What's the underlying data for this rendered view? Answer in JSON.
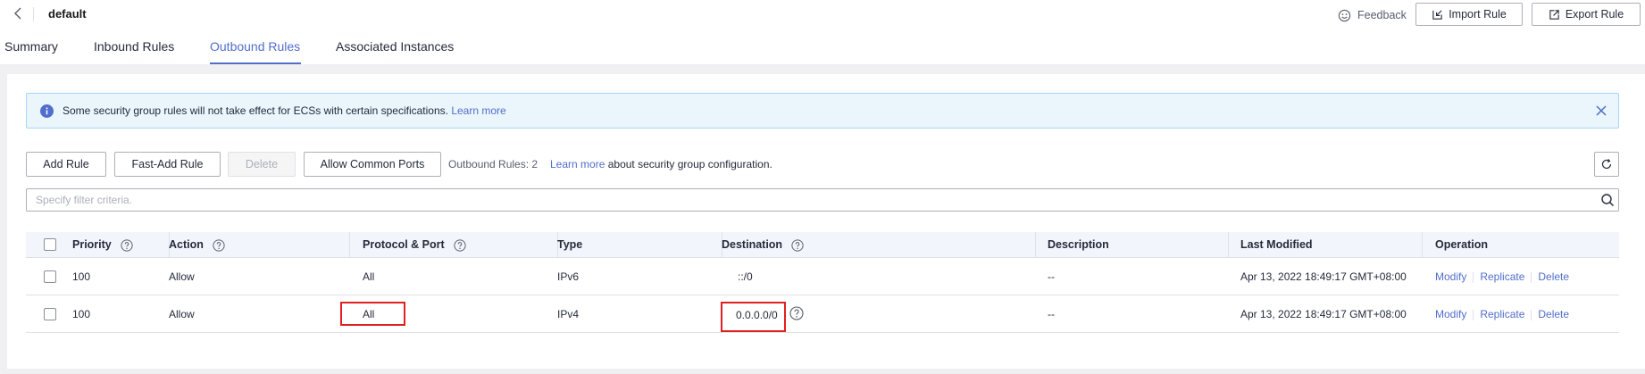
{
  "header": {
    "title": "default",
    "feedback_label": "Feedback",
    "import_label": "Import Rule",
    "export_label": "Export Rule"
  },
  "tabs": [
    {
      "label": "Summary",
      "active": false
    },
    {
      "label": "Inbound Rules",
      "active": false
    },
    {
      "label": "Outbound Rules",
      "active": true
    },
    {
      "label": "Associated Instances",
      "active": false
    }
  ],
  "alert": {
    "text": "Some security group rules will not take effect for ECSs with certain specifications.",
    "link": "Learn more"
  },
  "toolbar": {
    "add_rule": "Add Rule",
    "fast_add_rule": "Fast-Add Rule",
    "delete": "Delete",
    "allow_common_ports": "Allow Common Ports",
    "rule_count": "Outbound Rules: 2",
    "learn_more": "Learn more",
    "learn_more_suffix": "about security group configuration."
  },
  "search": {
    "placeholder": "Specify filter criteria."
  },
  "table": {
    "columns": [
      "Priority",
      "Action",
      "Protocol & Port",
      "Type",
      "Destination",
      "Description",
      "Last Modified",
      "Operation"
    ],
    "rows": [
      {
        "priority": "100",
        "action": "Allow",
        "protocol_port": "All",
        "type": "IPv6",
        "destination": "::/0",
        "description": "--",
        "last_modified": "Apr 13, 2022 18:49:17 GMT+08:00"
      },
      {
        "priority": "100",
        "action": "Allow",
        "protocol_port": "All",
        "type": "IPv4",
        "destination": "0.0.0.0/0",
        "description": "--",
        "last_modified": "Apr 13, 2022 18:49:17 GMT+08:00"
      }
    ],
    "operations": [
      "Modify",
      "Replicate",
      "Delete"
    ]
  },
  "colors": {
    "accent": "#526ecc",
    "highlight": "#e02020",
    "alert_bg": "#eaf5fc",
    "alert_icon": "#526ecc"
  },
  "icons": {
    "back": "chevron-left-icon",
    "feedback": "smiley-icon",
    "import": "import-icon",
    "export": "export-icon",
    "alert": "info-icon",
    "close": "close-icon",
    "refresh": "refresh-icon",
    "search": "search-icon",
    "help": "question-circle-icon"
  }
}
